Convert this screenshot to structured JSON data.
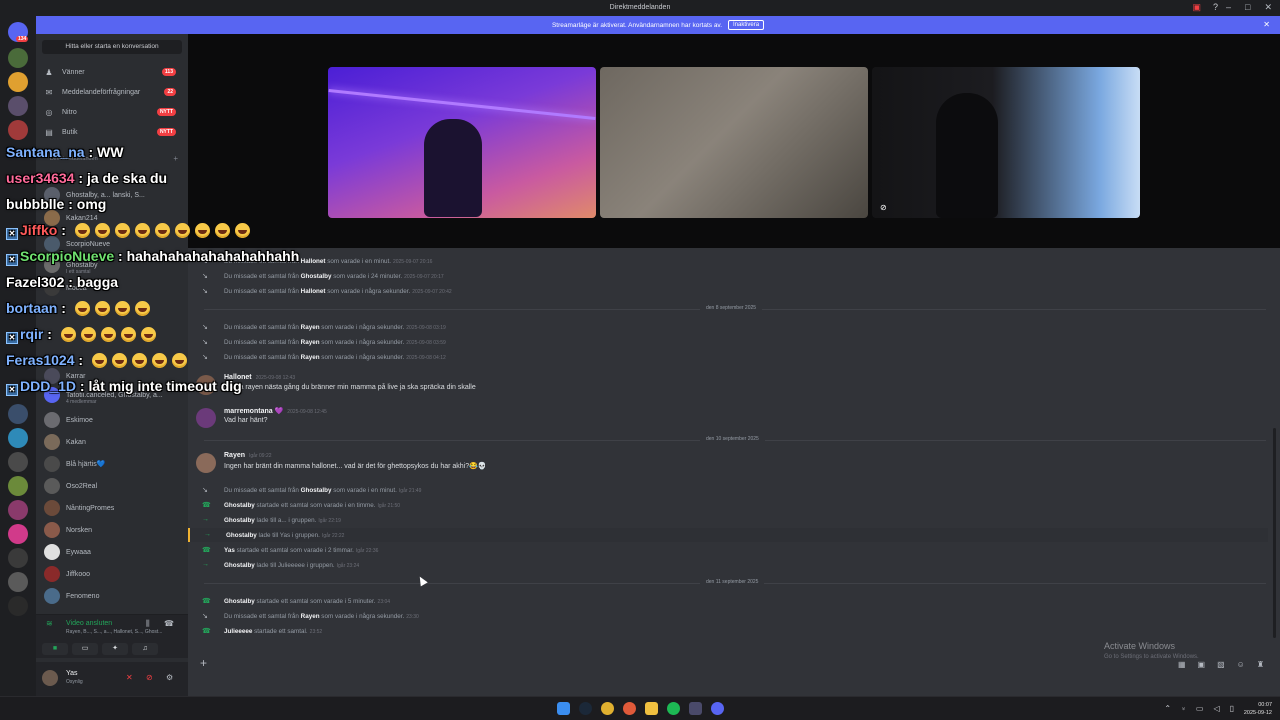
{
  "window": {
    "title": "Direktmeddelanden"
  },
  "banner": {
    "text": "Streamarläge är aktiverat. Användarnamnen har kortats av.",
    "button": "Inaktivera"
  },
  "sidebar": {
    "find": "Hitta eller starta en konversation",
    "nav": [
      {
        "label": "Vänner",
        "badge": "113"
      },
      {
        "label": "Meddelandeförfrågningar",
        "badge": "22"
      },
      {
        "label": "Nitro",
        "badge": "NYTT"
      },
      {
        "label": "Butik",
        "badge": "NYTT"
      }
    ],
    "dm_header": "Direktmeddelanden",
    "dms": [
      {
        "name": "Ghostalby, a... lanski, S..."
      },
      {
        "name": "Kakan214"
      },
      {
        "name": "ScorpioNueve"
      },
      {
        "name": "Ghostalby",
        "sub": "I ett samtal"
      },
      {
        "name": "Mocca"
      },
      {
        "name": "Karrar"
      },
      {
        "name": "Tatotii.canceled, Ghostalby, a...",
        "sub": "4 medlemmar"
      },
      {
        "name": "Eskimoe"
      },
      {
        "name": "Kakan"
      },
      {
        "name": "Blå hjärtis💙"
      },
      {
        "name": "Oso2Real"
      },
      {
        "name": "NåntingPromes"
      },
      {
        "name": "Norsken"
      },
      {
        "name": "Eywaaa"
      },
      {
        "name": "Jiffkooo"
      },
      {
        "name": "Fenomeno"
      }
    ],
    "voice": {
      "status": "Video ansluten",
      "members": "Rayen, B..., S..., a..., Hallonet, S..., Ghost..."
    },
    "user": {
      "name": "Yas",
      "status": "Osynlig"
    }
  },
  "chat": {
    "rows": [
      {
        "pre": "Du missade ett samtal från ",
        "who": "Hallonet",
        "post": " som varade i en minut.",
        "ts": "2025-09-07 20:16",
        "kind": "missed"
      },
      {
        "pre": "Du missade ett samtal från ",
        "who": "Ghostalby",
        "post": " som varade i 24 minuter.",
        "ts": "2025-09-07 20:17",
        "kind": "missed"
      },
      {
        "pre": "Du missade ett samtal från ",
        "who": "Hallonet",
        "post": " som varade i några sekunder.",
        "ts": "2025-09-07 20:42",
        "kind": "missed"
      }
    ],
    "day1": "den 8 september 2025",
    "rows2": [
      {
        "pre": "Du missade ett samtal från ",
        "who": "Rayen",
        "post": " som varade i några sekunder.",
        "ts": "2025-09-08 03:19"
      },
      {
        "pre": "Du missade ett samtal från ",
        "who": "Rayen",
        "post": " som varade i några sekunder.",
        "ts": "2025-09-08 03:59"
      },
      {
        "pre": "Du missade ett samtal från ",
        "who": "Rayen",
        "post": " som varade i några sekunder.",
        "ts": "2025-09-08 04:12"
      }
    ],
    "msg1": {
      "name": "Hallonet",
      "ts": "2025-09-08 12:43",
      "text": "gahba rayen nästa gång du bränner min mamma på live ja ska spräcka din skalle"
    },
    "msg2": {
      "name": "marremontana 💜",
      "ts": "2025-09-08 12:45",
      "text": "Vad har hänt?"
    },
    "day2": "den 10 september 2025",
    "msg3": {
      "name": "Rayen",
      "ts": "Igår 09:22",
      "text": "Ingen har bränt din mamma hallonet... vad är det för ghettopsykos du har akhi?😂💀"
    },
    "rows3": [
      {
        "pre": "Du missade ett samtal från ",
        "who": "Ghostalby",
        "post": " som varade i en minut.",
        "ts": "Igår 21:49",
        "kind": "missed"
      },
      {
        "pre": "",
        "who": "Ghostalby",
        "post": " startade ett samtal som varade i en timme.",
        "ts": "Igår 21:50",
        "kind": "call"
      },
      {
        "pre": "",
        "who": "Ghostalby",
        "post": " lade till a... i gruppen.",
        "ts": "Igår 22:19",
        "kind": "add"
      },
      {
        "pre": "",
        "who": "Ghostalby",
        "post": " lade till Yas i gruppen.",
        "ts": "Igår 22:22",
        "kind": "add"
      },
      {
        "pre": "",
        "who": "Yas",
        "post": " startade ett samtal som varade i 2 timmar.",
        "ts": "Igår 22:36",
        "kind": "call"
      },
      {
        "pre": "",
        "who": "Ghostalby",
        "post": " lade till Julieeeee i gruppen.",
        "ts": "Igår 23:24",
        "kind": "add"
      }
    ],
    "day3": "den 11 september 2025",
    "rows4": [
      {
        "pre": "",
        "who": "Ghostalby",
        "post": " startade ett samtal som varade i 5 minuter.",
        "ts": "23:04",
        "kind": "call"
      },
      {
        "pre": "Du missade ett samtal från ",
        "who": "Rayen",
        "post": " som varade i några sekunder.",
        "ts": "23:30",
        "kind": "missed"
      },
      {
        "pre": "",
        "who": "Julieeeee",
        "post": " startade ett samtal.",
        "ts": "23:52",
        "kind": "call"
      }
    ]
  },
  "watermark": {
    "title": "Activate Windows",
    "sub": "Go to Settings to activate Windows."
  },
  "overlay": [
    {
      "user": "Santana_na",
      "color": "#7fb2ff",
      "text": "WW",
      "emojis": 0,
      "badge": false
    },
    {
      "user": "user34634",
      "color": "#ff6a9a",
      "text": "ja de ska du",
      "emojis": 0,
      "badge": false
    },
    {
      "user": "bubbblle",
      "color": "#ffffff",
      "text": "omg",
      "emojis": 0,
      "badge": false
    },
    {
      "user": "Jiffko",
      "color": "#ff5a5a",
      "text": "",
      "emojis": 9,
      "badge": true
    },
    {
      "user": "ScorpioNueve",
      "color": "#6fe06f",
      "text": "hahahahahahahahahhahh",
      "emojis": 0,
      "badge": true
    },
    {
      "user": "Fazel302",
      "color": "#ffffff",
      "text": "bagga",
      "emojis": 0,
      "badge": false
    },
    {
      "user": "bortaan",
      "color": "#7fb2ff",
      "text": "",
      "emojis": 4,
      "badge": false
    },
    {
      "user": "rqir",
      "color": "#7fb2ff",
      "text": "",
      "emojis": 5,
      "badge": true
    },
    {
      "user": "Feras1024",
      "color": "#7fb2ff",
      "text": "",
      "emojis": 5,
      "badge": false
    },
    {
      "user": "DDD_1D",
      "color": "#7fb2ff",
      "text": "låt mig inte timeout dig",
      "emojis": 0,
      "badge": true
    }
  ],
  "clock": {
    "time": "00:07",
    "date": "2025-09-12"
  },
  "colors": {
    "accent": "#5865f2",
    "green": "#23a55a",
    "red": "#f23f43"
  }
}
